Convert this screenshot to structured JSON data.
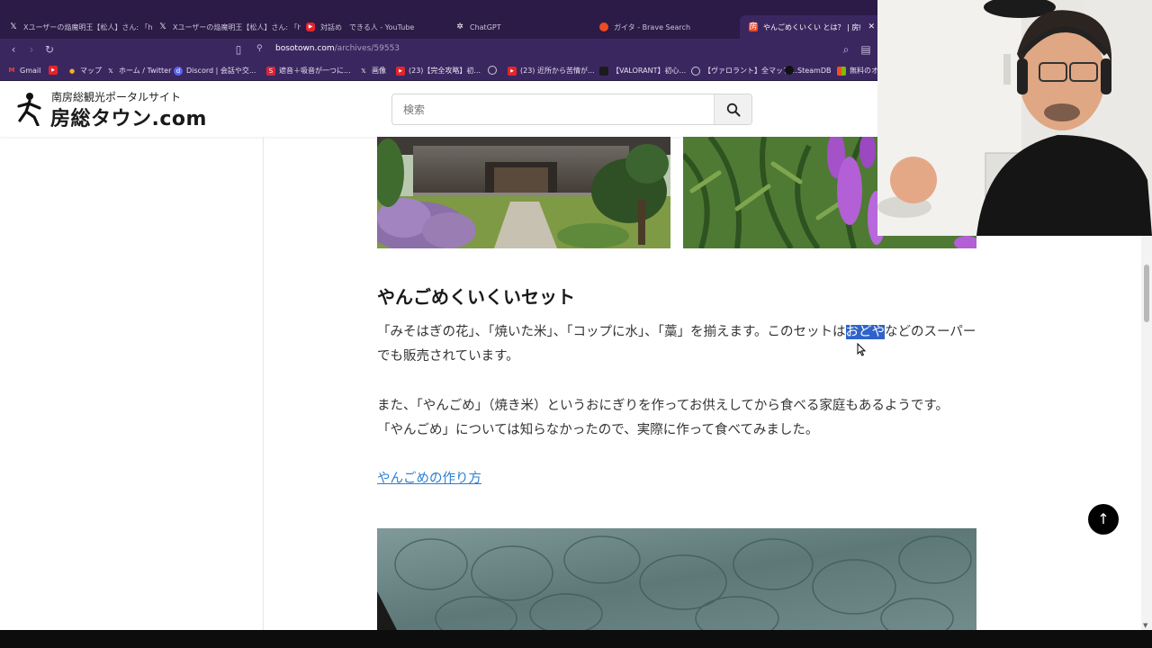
{
  "browser": {
    "tabs": [
      {
        "label": "Xユーザーの焔魔明王【松人】さん: 「https:",
        "icon": "x-icon"
      },
      {
        "label": "Xユーザーの焔魔明王【松人】さん: 「https:",
        "icon": "x-icon"
      },
      {
        "label": "対話め　できる人 - YouTube",
        "icon": "youtube-icon"
      },
      {
        "label": "ChatGPT",
        "icon": "chatgpt-icon"
      },
      {
        "label": "ガイタ - Brave Search",
        "icon": "brave-icon"
      },
      {
        "label": "やんごめくいくい とは？ | 房総タウン",
        "icon": "bosotown-icon",
        "close": "✕"
      }
    ],
    "url_domain": "bosotown.com",
    "url_path": "/archives/59553",
    "bookmarks": [
      {
        "label": "Gmail",
        "icon": "gmail-icon"
      },
      {
        "label": "",
        "icon": "youtube-icon"
      },
      {
        "label": "マップ",
        "icon": "maps-icon"
      },
      {
        "label": "ホーム / Twitter",
        "icon": "x-icon"
      },
      {
        "label": "Discord | 会話や交...",
        "icon": "discord-icon"
      },
      {
        "label": "遮音＋吸音が一つに...",
        "icon": "bookmark-icon"
      },
      {
        "label": "画像",
        "icon": "x-icon"
      },
      {
        "label": "(23)【完全攻略】初...",
        "icon": "youtube-icon"
      },
      {
        "label": "",
        "icon": "globe-icon"
      },
      {
        "label": "(23) 近所から苦情が...",
        "icon": "youtube-icon"
      },
      {
        "label": "【VALORANT】初心...",
        "icon": "bookmark-icon"
      },
      {
        "label": "【ヴァロラント】全マップ...",
        "icon": "bookmark-icon"
      },
      {
        "label": "SteamDB",
        "icon": "steam-icon"
      },
      {
        "label": "無料のオ",
        "icon": "windows-icon"
      }
    ]
  },
  "site": {
    "logo_sub": "南房総観光ポータルサイト",
    "logo_main": "房総タウン.com",
    "search_placeholder": "検索"
  },
  "article": {
    "heading": "やんごめくいくいセット",
    "p1_line1_before": "「みそはぎの花」、「焼いた米」、「コップに水」、「藁」を揃えます。このセットは",
    "p1_line1_highlight": "おどや",
    "p1_line1_after": "などのスーパー",
    "p1_line2": "でも販売されています。",
    "p2_line1": "また、「やんごめ」（焼き米）というおにぎりを作ってお供えしてから食べる家庭もあるようです。",
    "p2_line2": "「やんごめ」については知らなかったので、実際に作って食べてみました。",
    "link": "やんごめの作り方"
  },
  "scroll_top_label": "↑"
}
